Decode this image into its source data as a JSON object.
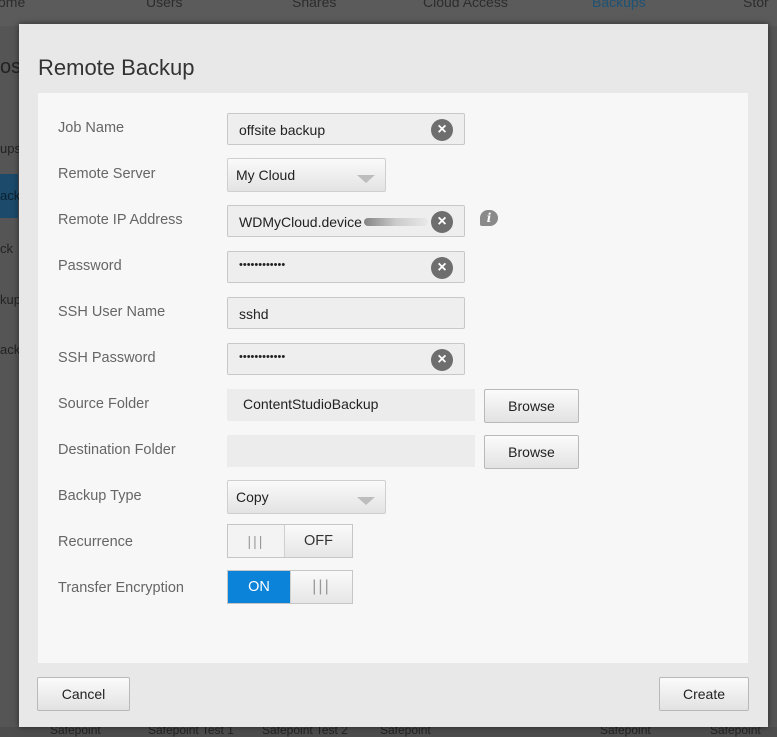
{
  "background": {
    "nav": [
      "ome",
      "Users",
      "Shares",
      "Cloud Access",
      "Backups",
      "Stor"
    ],
    "left_fragments": [
      "os",
      "ups",
      "ack",
      "ck",
      "kup",
      "ack"
    ],
    "bottom_fragments": [
      "Safepoint",
      "Safepoint Test 1",
      "Safepoint Test 2",
      "Safepoint",
      "Safepoint",
      "Safepoint"
    ]
  },
  "dialog": {
    "title": "Remote Backup",
    "fields": {
      "job_name": {
        "label": "Job Name",
        "value": "offsite backup"
      },
      "remote_server": {
        "label": "Remote Server",
        "value": "My Cloud"
      },
      "remote_ip": {
        "label": "Remote IP Address",
        "value": "WDMyCloud.device"
      },
      "password": {
        "label": "Password",
        "value": "••••••••••••"
      },
      "ssh_user": {
        "label": "SSH User Name",
        "value": "sshd"
      },
      "ssh_password": {
        "label": "SSH Password",
        "value": "••••••••••••"
      },
      "source_folder": {
        "label": "Source Folder",
        "value": "ContentStudioBackup",
        "browse": "Browse"
      },
      "destination_folder": {
        "label": "Destination Folder",
        "value": "",
        "browse": "Browse"
      },
      "backup_type": {
        "label": "Backup Type",
        "value": "Copy"
      },
      "recurrence": {
        "label": "Recurrence",
        "state": "OFF"
      },
      "transfer_encryption": {
        "label": "Transfer Encryption",
        "state": "ON"
      }
    },
    "buttons": {
      "cancel": "Cancel",
      "create": "Create"
    },
    "clear_glyph": "×",
    "info_glyph": "i",
    "grip_glyph": "|||"
  },
  "colors": {
    "accent": "#0a83d8",
    "dialog_bg": "#e8e8e8",
    "panel_bg": "#f7f7f7"
  }
}
